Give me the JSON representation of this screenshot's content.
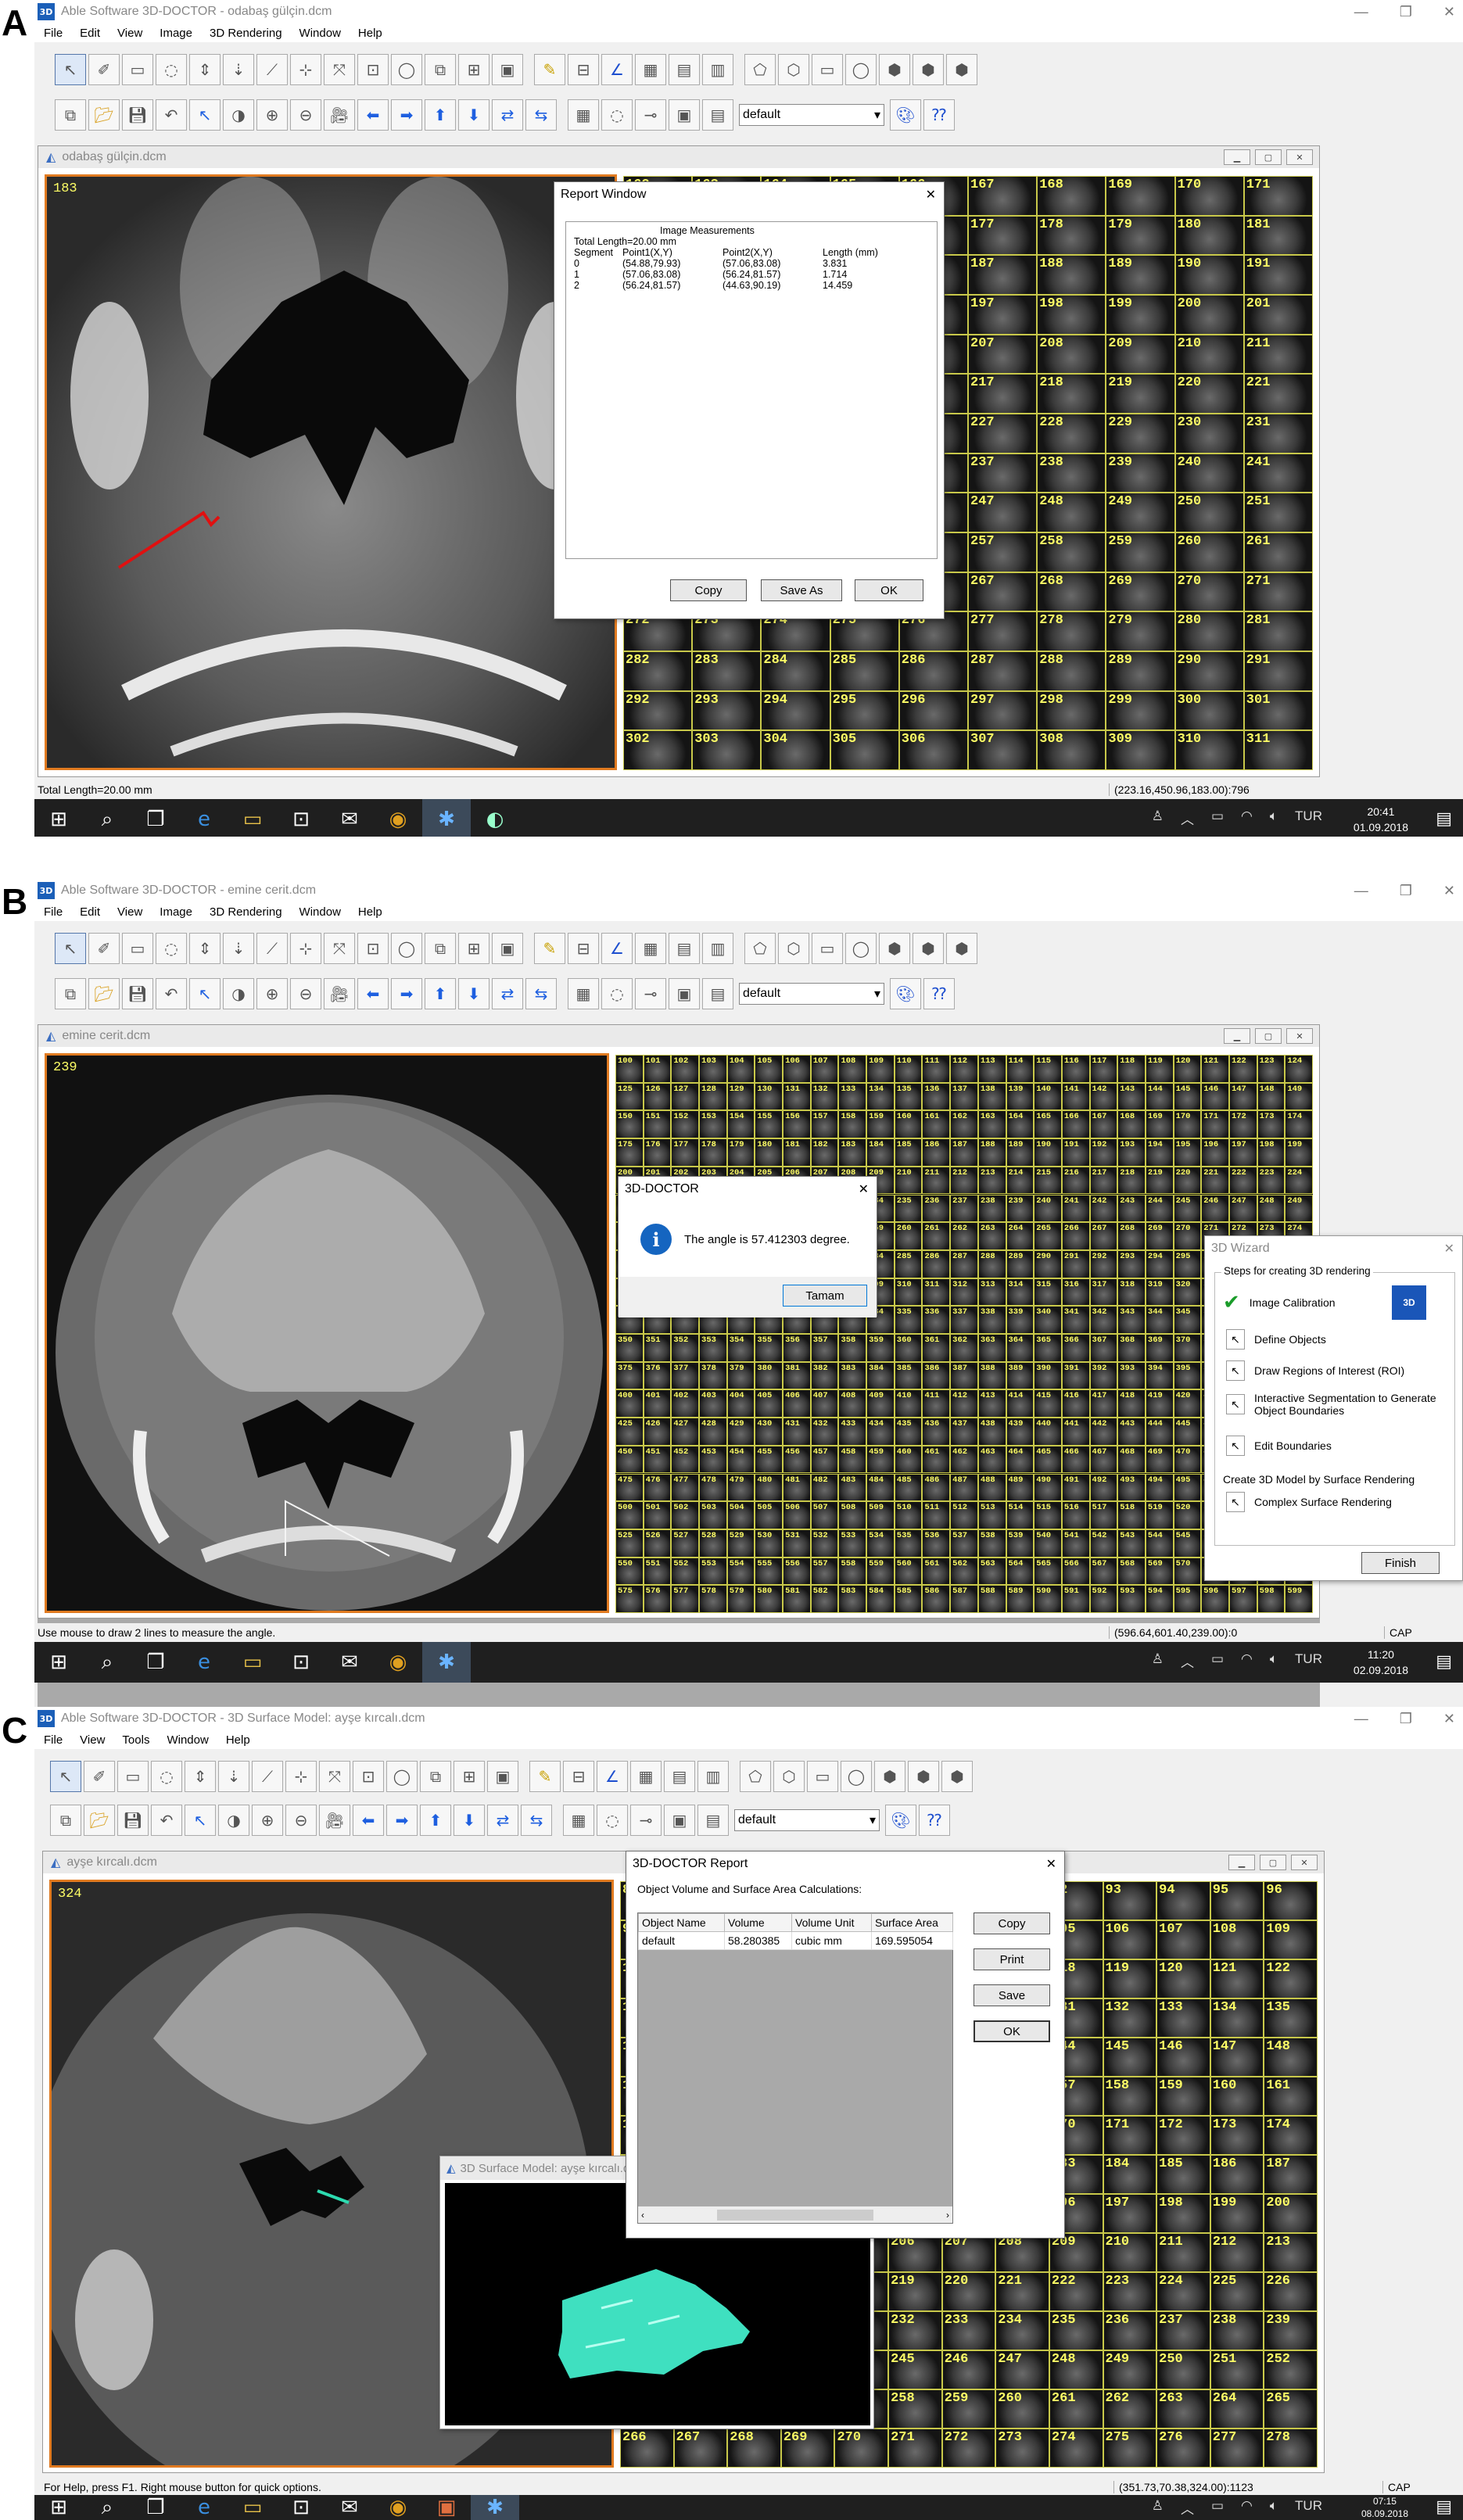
{
  "panels": [
    {
      "label": "A",
      "window_title": "Able Software 3D-DOCTOR - odabaş gülçin.dcm",
      "menus": [
        "File",
        "Edit",
        "View",
        "Image",
        "3D Rendering",
        "Window",
        "Help"
      ],
      "dropdown_value": "default",
      "child_title": "odabaş gülçin.dcm",
      "slice_number": "183",
      "status_left": "Total Length=20.00 mm",
      "status_right": "(223.16,450.96,183.00):796",
      "clock_time": "20:41",
      "clock_date": "01.09.2018",
      "lang": "TUR",
      "thumb_start": 162,
      "thumb_cols": 10,
      "thumb_rows": 15
    },
    {
      "label": "B",
      "window_title": "Able Software 3D-DOCTOR - emine cerit.dcm",
      "menus": [
        "File",
        "Edit",
        "View",
        "Image",
        "3D Rendering",
        "Window",
        "Help"
      ],
      "dropdown_value": "default",
      "child_title": "emine cerit.dcm",
      "slice_number": "239",
      "status_left": "Use mouse to draw 2 lines to measure the angle.",
      "status_right": "(596.64,601.40,239.00):0",
      "status_cap": "CAP",
      "clock_time": "11:20",
      "clock_date": "02.09.2018",
      "lang": "TUR",
      "thumb_start": 100,
      "thumb_cols": 25,
      "thumb_rows": 20
    },
    {
      "label": "C",
      "window_title": "Able Software 3D-DOCTOR - 3D Surface Model: ayşe kırcalı.dcm",
      "menus": [
        "File",
        "View",
        "Tools",
        "Window",
        "Help"
      ],
      "dropdown_value": "default",
      "child_title": "ayşe kırcalı.dcm",
      "slice_number": "324",
      "status_left": "For Help, press F1. Right mouse button for quick options.",
      "status_right": "(351.73,70.38,324.00):1123",
      "status_cap": "CAP",
      "clock_time": "07:15",
      "clock_date": "08.09.2018",
      "lang": "TUR",
      "thumb_start": 84,
      "thumb_cols": 13,
      "thumb_rows": 15
    }
  ],
  "report_window": {
    "title": "Report Window",
    "heading": "Image Measurements",
    "total": "Total Length=20.00 mm",
    "columns": [
      "Segment",
      "Point1(X,Y)",
      "Point2(X,Y)",
      "Length (mm)"
    ],
    "rows": [
      [
        "0",
        "(54.88,79.93)",
        "(57.06,83.08)",
        "3.831"
      ],
      [
        "1",
        "(57.06,83.08)",
        "(56.24,81.57)",
        "1.714"
      ],
      [
        "2",
        "(56.24,81.57)",
        "(44.63,90.19)",
        "14.459"
      ]
    ],
    "buttons": [
      "Copy",
      "Save As",
      "OK"
    ]
  },
  "angle_dialog": {
    "title": "3D-DOCTOR",
    "message": "The angle is 57.412303 degree.",
    "button": "Tamam"
  },
  "wizard": {
    "title": "3D Wizard",
    "group": "Steps for creating 3D rendering",
    "steps": [
      "Image Calibration",
      "Define Objects",
      "Draw Regions of Interest (ROI)",
      "Interactive Segmentation to Generate Object Boundaries",
      "Edit Boundaries"
    ],
    "section": "Create 3D Model by Surface Rendering",
    "substep": "Complex Surface Rendering",
    "finish": "Finish"
  },
  "report_c": {
    "title": "3D-DOCTOR Report",
    "subtitle": "Object Volume and Surface Area Calculations:",
    "columns": [
      "Object Name",
      "Volume",
      "Volume Unit",
      "Surface Area"
    ],
    "row": [
      "default",
      "58.280385",
      "cubic mm",
      "169.595054"
    ],
    "buttons": [
      "Copy",
      "Print",
      "Save",
      "OK"
    ]
  },
  "surface_window": {
    "title": "3D Surface Model: ayşe kırcalı.dcm",
    "model_color": "#3fe0c0"
  },
  "icons": [
    "select-arrow-icon",
    "zoom-in-icon",
    "zoom-out-icon",
    "camera-icon",
    "arrow-left-icon",
    "arrow-right-icon",
    "save-icon",
    "open-folder-icon"
  ]
}
